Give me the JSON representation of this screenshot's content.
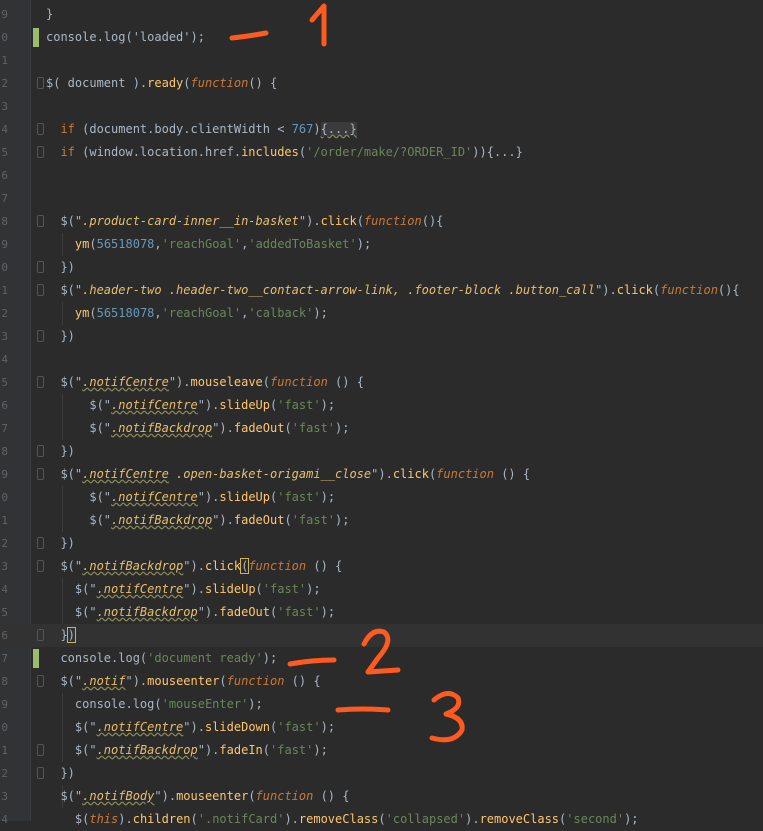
{
  "editor": {
    "lines": [
      [
        {
          "t": "}",
          "c": "plain"
        }
      ],
      [
        {
          "t": "console.log('loaded');",
          "c": "plain"
        }
      ],
      [],
      [
        {
          "t": "$( document ).",
          "c": "plain"
        },
        {
          "t": "ready",
          "c": "fn"
        },
        {
          "t": "(",
          "c": "plain"
        },
        {
          "t": "function",
          "c": "kw"
        },
        {
          "t": "() {",
          "c": "plain"
        }
      ],
      [],
      [
        {
          "t": "  ",
          "c": "plain"
        },
        {
          "t": "if",
          "c": "kwp"
        },
        {
          "t": " (document.body.clientWidth < ",
          "c": "plain"
        },
        {
          "t": "767",
          "c": "num"
        },
        {
          "t": ")",
          "c": "plain"
        },
        {
          "t": "{...}",
          "c": "fold"
        }
      ],
      [
        {
          "t": "  ",
          "c": "plain"
        },
        {
          "t": "if",
          "c": "kwp"
        },
        {
          "t": " (window.location.href.",
          "c": "plain"
        },
        {
          "t": "includes",
          "c": "fn"
        },
        {
          "t": "(",
          "c": "plain"
        },
        {
          "t": "'/order/make/?ORDER_ID'",
          "c": "str"
        },
        {
          "t": ")){...}",
          "c": "plain"
        }
      ],
      [],
      [],
      [
        {
          "t": "  $(\"",
          "c": "plain"
        },
        {
          "t": ".product-card-inner__in-basket",
          "c": "css"
        },
        {
          "t": "\").",
          "c": "plain"
        },
        {
          "t": "click",
          "c": "fn"
        },
        {
          "t": "(",
          "c": "plain"
        },
        {
          "t": "function",
          "c": "kw"
        },
        {
          "t": "(){",
          "c": "plain"
        }
      ],
      [
        {
          "t": "    ",
          "c": "plain"
        },
        {
          "t": "ym",
          "c": "fn"
        },
        {
          "t": "(",
          "c": "plain"
        },
        {
          "t": "56518078",
          "c": "num"
        },
        {
          "t": ",",
          "c": "plain"
        },
        {
          "t": "'reachGoal'",
          "c": "str"
        },
        {
          "t": ",",
          "c": "plain"
        },
        {
          "t": "'addedToBasket'",
          "c": "str"
        },
        {
          "t": ");",
          "c": "plain"
        }
      ],
      [
        {
          "t": "  })",
          "c": "plain"
        }
      ],
      [
        {
          "t": "  $(\"",
          "c": "plain"
        },
        {
          "t": ".header-two .header-two__contact-arrow-link, .footer-block .button_call",
          "c": "css"
        },
        {
          "t": "\").",
          "c": "plain"
        },
        {
          "t": "click",
          "c": "fn"
        },
        {
          "t": "(",
          "c": "plain"
        },
        {
          "t": "function",
          "c": "kw"
        },
        {
          "t": "(){",
          "c": "plain"
        }
      ],
      [
        {
          "t": "    ",
          "c": "plain"
        },
        {
          "t": "ym",
          "c": "fn"
        },
        {
          "t": "(",
          "c": "plain"
        },
        {
          "t": "56518078",
          "c": "num"
        },
        {
          "t": ",",
          "c": "plain"
        },
        {
          "t": "'reachGoal'",
          "c": "str"
        },
        {
          "t": ",",
          "c": "plain"
        },
        {
          "t": "'calback'",
          "c": "str"
        },
        {
          "t": ");",
          "c": "plain"
        }
      ],
      [
        {
          "t": "  })",
          "c": "plain"
        }
      ],
      [],
      [
        {
          "t": "  $(\"",
          "c": "plain"
        },
        {
          "t": ".notifCentre",
          "c": "cssu"
        },
        {
          "t": "\").",
          "c": "plain"
        },
        {
          "t": "mouseleave",
          "c": "fn"
        },
        {
          "t": "(",
          "c": "plain"
        },
        {
          "t": "function",
          "c": "kw"
        },
        {
          "t": " () {",
          "c": "plain"
        }
      ],
      [
        {
          "t": "      $(\"",
          "c": "plain"
        },
        {
          "t": ".notifCentre",
          "c": "cssu"
        },
        {
          "t": "\").",
          "c": "plain"
        },
        {
          "t": "slideUp",
          "c": "fn"
        },
        {
          "t": "(",
          "c": "plain"
        },
        {
          "t": "'fast'",
          "c": "str"
        },
        {
          "t": ");",
          "c": "plain"
        }
      ],
      [
        {
          "t": "      $(\"",
          "c": "plain"
        },
        {
          "t": ".notifBackdrop",
          "c": "cssu"
        },
        {
          "t": "\").",
          "c": "plain"
        },
        {
          "t": "fadeOut",
          "c": "fn"
        },
        {
          "t": "(",
          "c": "plain"
        },
        {
          "t": "'fast'",
          "c": "str"
        },
        {
          "t": ");",
          "c": "plain"
        }
      ],
      [
        {
          "t": "  })",
          "c": "plain"
        }
      ],
      [
        {
          "t": "  $(\"",
          "c": "plain"
        },
        {
          "t": ".notifCentre",
          "c": "cssu"
        },
        {
          "t": " .open-basket-origami__close",
          "c": "css"
        },
        {
          "t": "\").",
          "c": "plain"
        },
        {
          "t": "click",
          "c": "fn"
        },
        {
          "t": "(",
          "c": "plain"
        },
        {
          "t": "function",
          "c": "kw"
        },
        {
          "t": " () {",
          "c": "plain"
        }
      ],
      [
        {
          "t": "      $(\"",
          "c": "plain"
        },
        {
          "t": ".notifCentre",
          "c": "cssu"
        },
        {
          "t": "\").",
          "c": "plain"
        },
        {
          "t": "slideUp",
          "c": "fn"
        },
        {
          "t": "(",
          "c": "plain"
        },
        {
          "t": "'fast'",
          "c": "str"
        },
        {
          "t": ");",
          "c": "plain"
        }
      ],
      [
        {
          "t": "      $(\"",
          "c": "plain"
        },
        {
          "t": ".notifBackdrop",
          "c": "cssu"
        },
        {
          "t": "\").",
          "c": "plain"
        },
        {
          "t": "fadeOut",
          "c": "fn"
        },
        {
          "t": "(",
          "c": "plain"
        },
        {
          "t": "'fast'",
          "c": "str"
        },
        {
          "t": ");",
          "c": "plain"
        }
      ],
      [
        {
          "t": "  })",
          "c": "plain"
        }
      ],
      [
        {
          "t": "  $(\"",
          "c": "plain"
        },
        {
          "t": ".notifBackdrop",
          "c": "cssu"
        },
        {
          "t": "\").",
          "c": "plain"
        },
        {
          "t": "click",
          "c": "fn"
        },
        {
          "t": "(",
          "c": "brace"
        },
        {
          "t": "function",
          "c": "kw"
        },
        {
          "t": " () {",
          "c": "plain"
        }
      ],
      [
        {
          "t": "    $(\"",
          "c": "plain"
        },
        {
          "t": ".notifCentre",
          "c": "cssu"
        },
        {
          "t": "\").",
          "c": "plain"
        },
        {
          "t": "slideUp",
          "c": "fn"
        },
        {
          "t": "(",
          "c": "plain"
        },
        {
          "t": "'fast'",
          "c": "str"
        },
        {
          "t": ");",
          "c": "plain"
        }
      ],
      [
        {
          "t": "    $(\"",
          "c": "plain"
        },
        {
          "t": ".notifBackdrop",
          "c": "cssu"
        },
        {
          "t": "\").",
          "c": "plain"
        },
        {
          "t": "fadeOut",
          "c": "fn"
        },
        {
          "t": "(",
          "c": "plain"
        },
        {
          "t": "'fast'",
          "c": "str"
        },
        {
          "t": ");",
          "c": "plain"
        }
      ],
      [
        {
          "t": "  }",
          "c": "plain"
        },
        {
          "t": ")",
          "c": "brace"
        }
      ],
      [
        {
          "t": "  console.log(",
          "c": "plain"
        },
        {
          "t": "'document ready'",
          "c": "str"
        },
        {
          "t": ");",
          "c": "plain"
        }
      ],
      [
        {
          "t": "  $(\"",
          "c": "plain"
        },
        {
          "t": ".notif",
          "c": "cssu"
        },
        {
          "t": "\").",
          "c": "plain"
        },
        {
          "t": "mouseenter",
          "c": "fn"
        },
        {
          "t": "(",
          "c": "plain"
        },
        {
          "t": "function",
          "c": "kw"
        },
        {
          "t": " () {",
          "c": "plain"
        }
      ],
      [
        {
          "t": "    console.log(",
          "c": "plain"
        },
        {
          "t": "'mouseEnter'",
          "c": "str"
        },
        {
          "t": ");",
          "c": "plain"
        }
      ],
      [
        {
          "t": "    $(\"",
          "c": "plain"
        },
        {
          "t": ".notifCentre",
          "c": "cssu"
        },
        {
          "t": "\").",
          "c": "plain"
        },
        {
          "t": "slideDown",
          "c": "fn"
        },
        {
          "t": "(",
          "c": "plain"
        },
        {
          "t": "'fast'",
          "c": "str"
        },
        {
          "t": ");",
          "c": "plain"
        }
      ],
      [
        {
          "t": "    $(\"",
          "c": "plain"
        },
        {
          "t": ".notifBackdrop",
          "c": "cssu"
        },
        {
          "t": "\").",
          "c": "plain"
        },
        {
          "t": "fadeIn",
          "c": "fn"
        },
        {
          "t": "(",
          "c": "plain"
        },
        {
          "t": "'fast'",
          "c": "str"
        },
        {
          "t": ");",
          "c": "plain"
        }
      ],
      [
        {
          "t": "  })",
          "c": "plain"
        }
      ],
      [
        {
          "t": "  $(\"",
          "c": "plain"
        },
        {
          "t": ".notifBody",
          "c": "cssu"
        },
        {
          "t": "\").",
          "c": "plain"
        },
        {
          "t": "mouseenter",
          "c": "fn"
        },
        {
          "t": "(",
          "c": "plain"
        },
        {
          "t": "function",
          "c": "kw"
        },
        {
          "t": " () {",
          "c": "plain"
        }
      ],
      [
        {
          "t": "    $(",
          "c": "plain"
        },
        {
          "t": "this",
          "c": "kw"
        },
        {
          "t": ").",
          "c": "plain"
        },
        {
          "t": "children",
          "c": "fn"
        },
        {
          "t": "(",
          "c": "plain"
        },
        {
          "t": "'.notifCard'",
          "c": "str"
        },
        {
          "t": ").",
          "c": "plain"
        },
        {
          "t": "removeClass",
          "c": "fn"
        },
        {
          "t": "(",
          "c": "plain"
        },
        {
          "t": "'collapsed'",
          "c": "str"
        },
        {
          "t": ").",
          "c": "plain"
        },
        {
          "t": "removeClass",
          "c": "fn"
        },
        {
          "t": "(",
          "c": "plain"
        },
        {
          "t": "'second'",
          "c": "str"
        },
        {
          "t": ");",
          "c": "plain"
        }
      ]
    ],
    "line_numbers": [
      "9",
      "0",
      "1",
      "2",
      "3",
      "4",
      "5",
      "6",
      "7",
      "8",
      "9",
      "0",
      "1",
      "2",
      "3",
      "4",
      "5",
      "6",
      "7",
      "8",
      "9",
      "0",
      "1",
      "2",
      "3",
      "4",
      "5",
      "6",
      "7",
      "8",
      "9",
      "0",
      "1",
      "2",
      "3",
      "4"
    ],
    "current_line_index": 27,
    "modified_line_indices": [
      1,
      28
    ]
  },
  "annotations": [
    {
      "label": "1",
      "color": "#ff5a1f"
    },
    {
      "label": "2",
      "color": "#ff5a1f"
    },
    {
      "label": "3",
      "color": "#ff5a1f"
    }
  ]
}
